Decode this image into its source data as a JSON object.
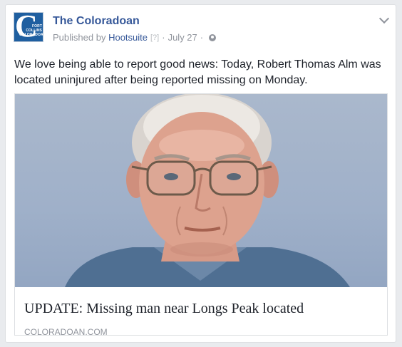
{
  "post": {
    "page_name": "The Coloradoan",
    "published_by": "Published by",
    "publisher": "Hootsuite",
    "help_marker": "[?]",
    "separator": "·",
    "date": "July 27",
    "text": "We love being able to report good news: Today, Robert Thomas Alm was located uninjured after being reported missing on Monday."
  },
  "avatar": {
    "letter": "C",
    "line1": "FORT COLLINS",
    "line2": "COLORADOAN"
  },
  "link": {
    "title": "UPDATE: Missing man near Longs Peak located",
    "domain": "COLORADOAN.COM"
  },
  "icons": {
    "options": "chevron-down-icon",
    "privacy": "globe-icon"
  },
  "colors": {
    "link_blue": "#365899",
    "meta_gray": "#90949c",
    "photo_bg": "#9fb0c9"
  }
}
